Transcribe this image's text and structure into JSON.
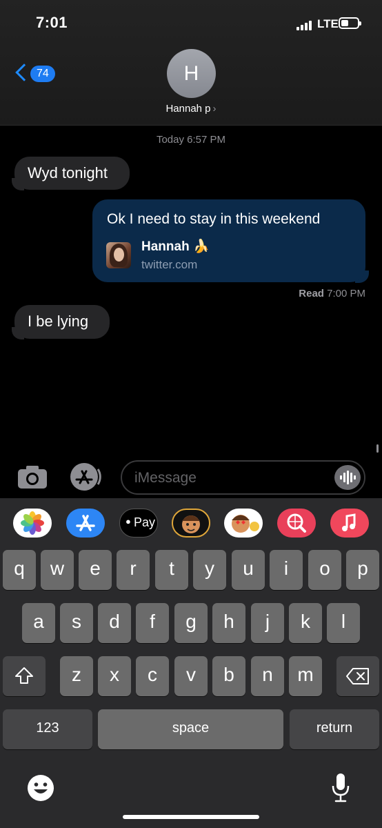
{
  "status_bar": {
    "time": "7:01",
    "network": "LTE"
  },
  "header": {
    "back_count": "74",
    "avatar_initial": "H",
    "contact_name": "Hannah p",
    "contact_chevron": "›"
  },
  "conversation": {
    "timestamp": "Today 6:57 PM",
    "messages": [
      {
        "direction": "incoming",
        "text": "Wyd tonight"
      },
      {
        "direction": "outgoing",
        "text": "Ok I need to stay in this weekend",
        "link_preview": {
          "title": "Hannah 🍌",
          "url": "twitter.com"
        }
      },
      {
        "direction": "incoming",
        "text": "I be lying"
      }
    ],
    "read_receipt": {
      "label": "Read",
      "time": "7:00 PM"
    }
  },
  "input_bar": {
    "placeholder": "iMessage"
  },
  "app_strip": [
    {
      "name": "photos",
      "label": ""
    },
    {
      "name": "app-store",
      "label": ""
    },
    {
      "name": "apple-pay",
      "label": "Pay"
    },
    {
      "name": "memoji",
      "label": ""
    },
    {
      "name": "memoji-stickers",
      "label": ""
    },
    {
      "name": "images-search",
      "label": ""
    },
    {
      "name": "music",
      "label": ""
    }
  ],
  "keyboard": {
    "row1": [
      "q",
      "w",
      "e",
      "r",
      "t",
      "y",
      "u",
      "i",
      "o",
      "p"
    ],
    "row2": [
      "a",
      "s",
      "d",
      "f",
      "g",
      "h",
      "j",
      "k",
      "l"
    ],
    "row3": [
      "z",
      "x",
      "c",
      "v",
      "b",
      "n",
      "m"
    ],
    "numbers_label": "123",
    "space_label": "space",
    "return_label": "return"
  },
  "colors": {
    "accent": "#1e7cf2",
    "incoming_bubble": "#262628",
    "outgoing_bubble": "#0b2a4a"
  }
}
